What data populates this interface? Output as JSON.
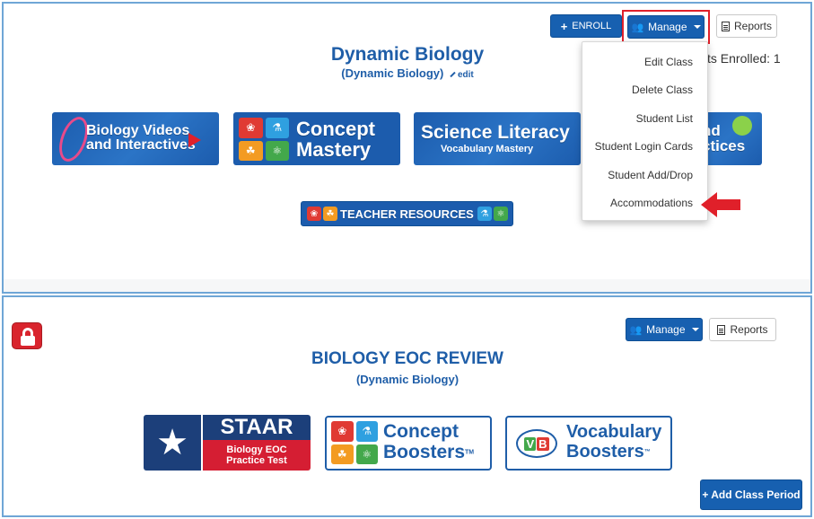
{
  "class1": {
    "enroll_label": "ENROLL",
    "manage_label": "Manage",
    "reports_label": "Reports",
    "title": "Dynamic Biology",
    "subtitle": "(Dynamic Biology)",
    "edit_label": "edit",
    "enrolled_text": "ts Enrolled: 1",
    "tiles": {
      "bvi_line1": "Biology Videos",
      "bvi_line2": "and Interactives",
      "cm_line1": "Concept",
      "cm_line2": "Mastery",
      "sl_title": "Science Literacy",
      "sl_sub": "Vocabulary Mastery",
      "lab_line1": "nd",
      "lab_line2": "ctices",
      "teacher_resources": "TEACHER RESOURCES"
    },
    "dropdown": {
      "items": [
        "Edit Class",
        "Delete Class",
        "Student List",
        "Student Login Cards",
        "Student Add/Drop",
        "Accommodations"
      ]
    }
  },
  "class2": {
    "manage_label": "Manage",
    "reports_label": "Reports",
    "title": "BIOLOGY EOC REVIEW",
    "subtitle": "(Dynamic Biology)",
    "tiles": {
      "staar_word": "STAAR",
      "staar_line1": "Biology EOC",
      "staar_line2": "Practice Test",
      "cb_line1": "Concept",
      "cb_line2": "Boosters",
      "vb_line1": "Vocabulary",
      "vb_line2": "Boosters",
      "vb_letter_v": "V",
      "vb_letter_b": "B",
      "tm": "TM"
    },
    "add_period_label": "+ Add Class Period"
  },
  "colors": {
    "brand_blue": "#1760b0",
    "panel_border": "#6fa6d6",
    "highlight_red": "#e0202a"
  }
}
